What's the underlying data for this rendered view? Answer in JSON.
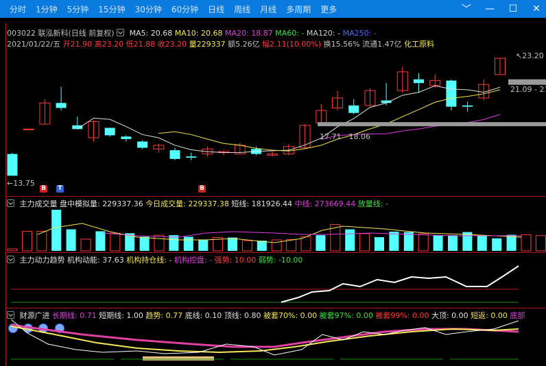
{
  "tabs": [
    "分时",
    "1分钟",
    "5分钟",
    "15分钟",
    "30分钟",
    "60分钟",
    "日线",
    "周线",
    "月线",
    "多周期",
    "更多"
  ],
  "window_buttons": [
    "﹀",
    "—",
    "☐",
    "✕"
  ],
  "header": {
    "stock": "003022 联泓新科(日线 前复权)",
    "ma5": "MA5: 20.68",
    "ma10": "MA10: 20.68",
    "ma20": "MA20: 18.87",
    "ma60": "MA60: -",
    "ma120": "MA120: -",
    "ma250": "MA250: -",
    "date": "2021/01/22/五",
    "open": "开21.90",
    "high": "高23.20",
    "low": "低21.88",
    "close": "收23.20",
    "volume": "量229337",
    "amount": "额5.26亿",
    "change": "幅2.11(10.00%)",
    "turnover": "换15.56%",
    "float": "流通1.47亿",
    "industry": "化工原料"
  },
  "price_labels": {
    "high": "23.20",
    "low": "13.75",
    "range_right": "21.09 - 21",
    "range_mid": "17.71 - 18.06"
  },
  "markers": [
    "B",
    "T",
    "B"
  ],
  "volume_legend": {
    "name": "主力成交量",
    "sim": "盘中模拟量: 229337.36",
    "today": "今日成交量: 229337.38",
    "short": "短线: 181926.44",
    "mid": "中线: 273669.44",
    "up": "放量线: -"
  },
  "trend_legend": {
    "name": "主力动力趋势",
    "power": "机构动能: 37.63",
    "hold": "机构持仓线: -",
    "ctrl": "机构控盘: -",
    "strong": "强势: 10.00",
    "weak": "弱势: -10.00"
  },
  "wealth_legend": {
    "name": "财源广进",
    "long": "长期线: 0.71",
    "short": "短期线: 1.00",
    "trend": "趋势: 0.77",
    "bottom": "底线: 0.10",
    "top": "顶线: 0.80",
    "trap70": "被套70%: 0.00",
    "trap97": "被套97%: 0.00",
    "trap99": "被套99%: 0.00",
    "bigtop": "大顶: 0.00",
    "shortback": "短返: 0.00",
    "tail": "底部"
  },
  "chart_data": {
    "type": "candlestick",
    "candles": [
      {
        "o": 15.5,
        "c": 13.75,
        "h": 15.6,
        "l": 13.75
      },
      {
        "o": 17.5,
        "c": 17.5,
        "h": 17.5,
        "l": 17.5
      },
      {
        "o": 17.9,
        "c": 19.6,
        "h": 19.9,
        "l": 17.9
      },
      {
        "o": 19.6,
        "c": 19.2,
        "h": 20.9,
        "l": 19.0
      },
      {
        "o": 17.8,
        "c": 17.5,
        "h": 18.5,
        "l": 17.5
      },
      {
        "o": 16.8,
        "c": 18.1,
        "h": 18.2,
        "l": 16.5
      },
      {
        "o": 17.6,
        "c": 17.0,
        "h": 17.6,
        "l": 16.9
      },
      {
        "o": 16.9,
        "c": 16.7,
        "h": 17.0,
        "l": 16.5
      },
      {
        "o": 16.5,
        "c": 16.0,
        "h": 16.6,
        "l": 15.9
      },
      {
        "o": 15.9,
        "c": 16.2,
        "h": 16.3,
        "l": 15.6
      },
      {
        "o": 15.8,
        "c": 15.1,
        "h": 16.0,
        "l": 15.0
      },
      {
        "o": 15.3,
        "c": 15.2,
        "h": 15.6,
        "l": 15.0
      },
      {
        "o": 15.5,
        "c": 15.9,
        "h": 16.1,
        "l": 15.3
      },
      {
        "o": 15.6,
        "c": 15.7,
        "h": 15.8,
        "l": 15.4
      },
      {
        "o": 15.5,
        "c": 16.2,
        "h": 16.4,
        "l": 15.5
      },
      {
        "o": 15.9,
        "c": 15.5,
        "h": 16.1,
        "l": 15.4
      },
      {
        "o": 15.4,
        "c": 15.5,
        "h": 15.7,
        "l": 15.3
      },
      {
        "o": 15.5,
        "c": 16.1,
        "h": 16.3,
        "l": 15.4
      },
      {
        "o": 16.0,
        "c": 17.8,
        "h": 17.9,
        "l": 15.9
      },
      {
        "o": 18.0,
        "c": 19.0,
        "h": 19.5,
        "l": 17.9
      },
      {
        "o": 19.2,
        "c": 20.0,
        "h": 20.6,
        "l": 19.0
      },
      {
        "o": 19.4,
        "c": 18.8,
        "h": 19.9,
        "l": 18.7
      },
      {
        "o": 19.4,
        "c": 20.6,
        "h": 20.8,
        "l": 19.3
      },
      {
        "o": 19.8,
        "c": 19.6,
        "h": 21.2,
        "l": 19.4
      },
      {
        "o": 20.6,
        "c": 22.1,
        "h": 22.5,
        "l": 20.4
      },
      {
        "o": 21.5,
        "c": 21.2,
        "h": 22.0,
        "l": 20.4
      },
      {
        "o": 21.0,
        "c": 21.4,
        "h": 21.9,
        "l": 20.8
      },
      {
        "o": 21.4,
        "c": 19.3,
        "h": 21.5,
        "l": 19.0
      },
      {
        "o": 19.4,
        "c": 19.3,
        "h": 19.7,
        "l": 18.9
      },
      {
        "o": 20.0,
        "c": 21.09,
        "h": 21.5,
        "l": 19.8
      },
      {
        "o": 21.88,
        "c": 23.2,
        "h": 23.2,
        "l": 21.88
      }
    ],
    "ma_price_range": [
      13.0,
      23.8
    ],
    "volume_values": [
      10,
      100,
      100,
      210,
      110,
      60,
      100,
      90,
      90,
      72,
      80,
      80,
      72,
      58,
      68,
      68,
      52,
      52,
      56,
      58,
      72,
      80,
      135,
      110,
      88,
      70,
      98,
      96,
      88,
      80,
      80,
      96,
      78,
      64,
      82,
      82,
      78
    ],
    "volume_up": [
      true,
      true,
      true,
      false,
      false,
      true,
      false,
      true,
      false,
      false,
      true,
      false,
      false,
      false,
      true,
      false,
      true,
      false,
      true,
      true,
      true,
      false,
      true,
      false,
      true,
      false,
      false,
      false,
      true,
      false,
      false,
      false,
      false,
      false,
      false,
      true,
      true
    ]
  }
}
